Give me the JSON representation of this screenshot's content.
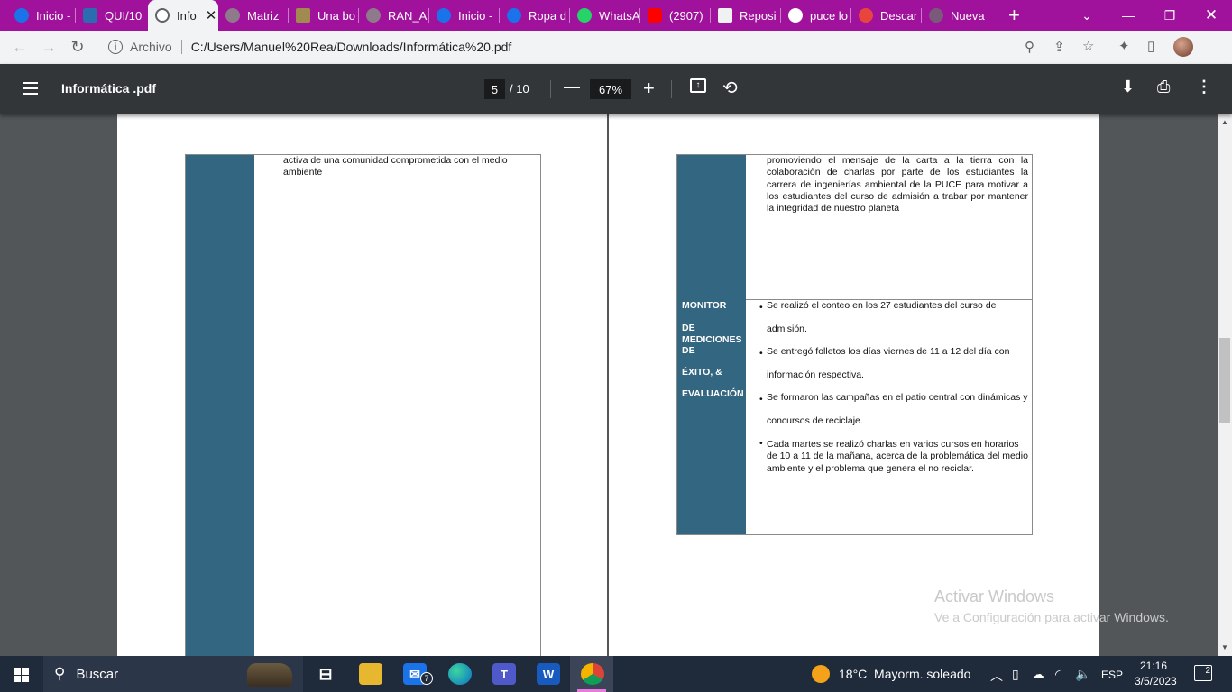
{
  "browser": {
    "tabs": [
      {
        "label": "Inicio -",
        "color": "#1a73e8"
      },
      {
        "label": "QUI/10",
        "color": "#2b6cb0"
      },
      {
        "label": "Info",
        "color": "#5f6368",
        "active": true
      },
      {
        "label": "Matriz",
        "color": "#8e7a8a"
      },
      {
        "label": "Una bo",
        "color": "#a08a50"
      },
      {
        "label": "RAN_A",
        "color": "#8e7a8a"
      },
      {
        "label": "Inicio -",
        "color": "#1a73e8"
      },
      {
        "label": "Ropa d",
        "color": "#1a73e8"
      },
      {
        "label": "WhatsA",
        "color": "#25d366"
      },
      {
        "label": "(2907)",
        "color": "#ff0000"
      },
      {
        "label": "Reposi",
        "color": "#222222"
      },
      {
        "label": "puce lo",
        "color": "#ffffff"
      },
      {
        "label": "Descar",
        "color": "#e8453c"
      },
      {
        "label": "Nueva",
        "color": "#7a5a7a"
      }
    ],
    "new_tab_icon": "plus-icon",
    "scheme_label": "Archivo",
    "url": "C:/Users/Manuel%20Rea/Downloads/Informática%20.pdf"
  },
  "pdf": {
    "title": "Informática .pdf",
    "current_page": "5",
    "total_pages": "/ 10",
    "zoom": "67%"
  },
  "left_page": {
    "text": "activa de una comunidad comprometida con el medio ambiente"
  },
  "right_page": {
    "top_text": "promoviendo el mensaje de la carta a la tierra con la colaboración de charlas por parte de los estudiantes la carrera de ingenierías ambiental de la PUCE para motivar a los estudiantes del curso de admisión a trabar por mantener la integridad de nuestro planeta",
    "header_lines": [
      "MONITOR",
      "DE",
      "MEDICIONES",
      "DE",
      "ÉXITO, &",
      "EVALUACIÓN"
    ],
    "bullets": [
      {
        "line1": "Se realizó el conteo en los 27 estudiantes del curso de",
        "line2": "admisión."
      },
      {
        "line1": "Se entregó folletos los días viernes de 11 a 12 del día con",
        "line2": "información respectiva."
      },
      {
        "line1": "Se formaron las campañas en el patio central con dinámicas y",
        "line2": "concursos de reciclaje."
      },
      {
        "line1": "Cada martes se realizó charlas en varios cursos en horarios de 10 a 11 de la mañana, acerca de la problemática del medio ambiente y el problema que genera el no reciclar.",
        "line2": ""
      }
    ]
  },
  "watermark": {
    "line1": "Activar Windows",
    "line2": "Ve a Configuración para activar Windows."
  },
  "taskbar": {
    "search_placeholder": "Buscar",
    "mail_badge": "7",
    "weather": "18°C  Mayorm. soleado",
    "language": "ESP",
    "time": "21:16",
    "date": "3/5/2023",
    "notifications": "2"
  },
  "colors": {
    "tabstrip": "#a0129c",
    "table_header_blue": "#336680",
    "pdf_toolbar": "#323639"
  }
}
